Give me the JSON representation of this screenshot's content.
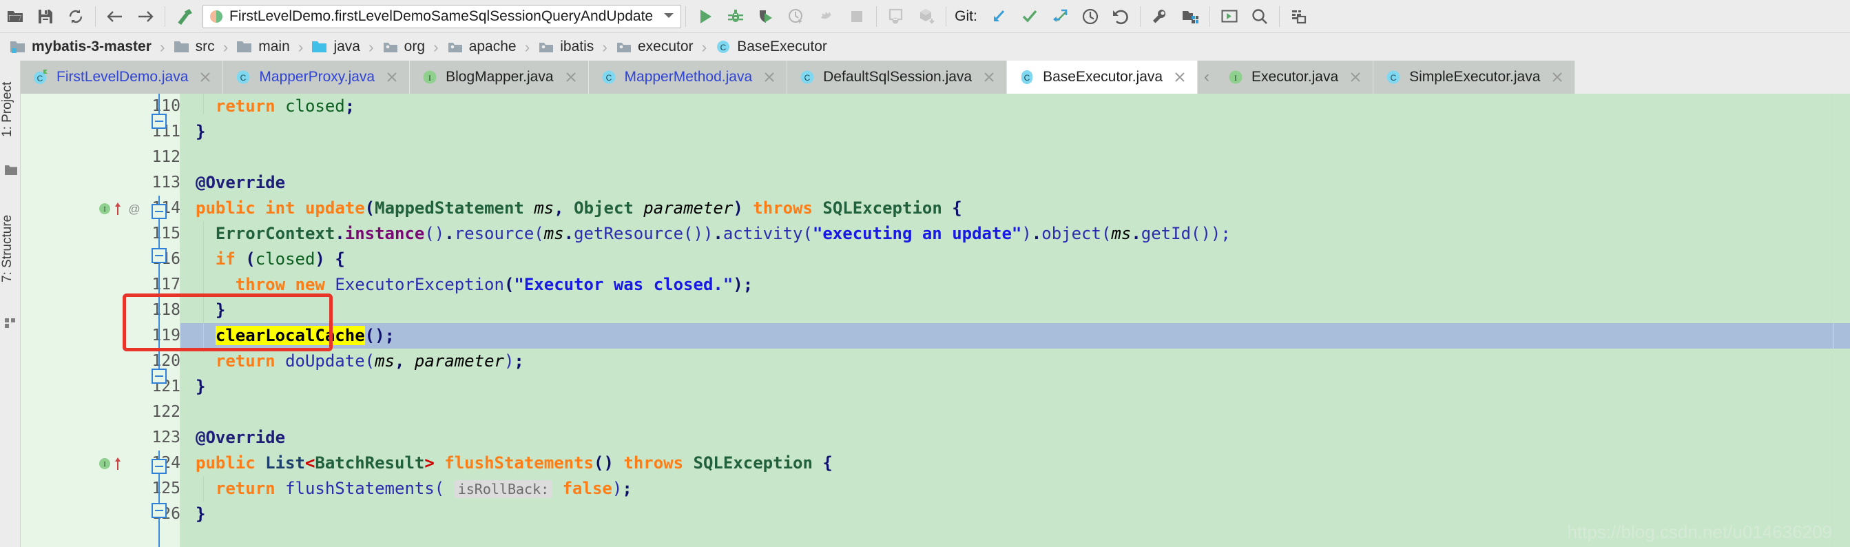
{
  "toolbar": {
    "icons_left": [
      {
        "name": "open-folder-icon",
        "label": "Open"
      },
      {
        "name": "save-all-icon",
        "label": "Save All"
      },
      {
        "name": "sync-icon",
        "label": "Synchronize"
      }
    ],
    "nav_icons": [
      {
        "name": "back-arrow-icon",
        "label": "Back"
      },
      {
        "name": "forward-arrow-icon",
        "label": "Forward"
      }
    ],
    "build_icon": {
      "name": "build-hammer-icon",
      "label": "Build Project"
    },
    "run_config": {
      "value": "FirstLevelDemo.firstLevelDemoSameSqlSessionQueryAndUpdate",
      "icon": "junit-config-icon",
      "dropdown_icon": "chevron-down-icon"
    },
    "run_icons": [
      {
        "name": "run-icon",
        "label": "Run"
      },
      {
        "name": "debug-icon",
        "label": "Debug"
      },
      {
        "name": "run-with-coverage-icon",
        "label": "Run with Coverage"
      },
      {
        "name": "profile-icon",
        "label": "Profile"
      },
      {
        "name": "attach-profiler-icon",
        "label": "Attach Profiler"
      },
      {
        "name": "stop-icon",
        "label": "Stop"
      }
    ],
    "android_icons": [
      {
        "name": "sync-gradle-icon",
        "label": "Sync Project"
      },
      {
        "name": "avd-manager-icon",
        "label": "AVD Manager"
      }
    ],
    "git_label": "Git:",
    "git_icons": [
      {
        "name": "update-project-icon",
        "label": "Update Project"
      },
      {
        "name": "commit-checkmark-icon",
        "label": "Commit"
      },
      {
        "name": "push-icon",
        "label": "Push"
      },
      {
        "name": "history-clock-icon",
        "label": "Show History"
      },
      {
        "name": "rollback-icon",
        "label": "Rollback"
      }
    ],
    "right_icons": [
      {
        "name": "settings-wrench-icon",
        "label": "Settings"
      },
      {
        "name": "project-structure-icon",
        "label": "Project Structure"
      },
      {
        "name": "run-anything-icon",
        "label": "Run Anything"
      },
      {
        "name": "search-everywhere-icon",
        "label": "Search Everywhere"
      },
      {
        "name": "select-in-icon",
        "label": "Select In"
      }
    ]
  },
  "breadcrumb": {
    "items": [
      {
        "label": "mybatis-3-master",
        "icon": "module-icon",
        "bold": true
      },
      {
        "label": "src",
        "icon": "folder-icon",
        "bold": false
      },
      {
        "label": "main",
        "icon": "folder-icon",
        "bold": false
      },
      {
        "label": "java",
        "icon": "source-root-icon",
        "bold": false
      },
      {
        "label": "org",
        "icon": "package-icon",
        "bold": false
      },
      {
        "label": "apache",
        "icon": "package-icon",
        "bold": false
      },
      {
        "label": "ibatis",
        "icon": "package-icon",
        "bold": false
      },
      {
        "label": "executor",
        "icon": "package-icon",
        "bold": false
      },
      {
        "label": "BaseExecutor",
        "icon": "class-icon",
        "bold": false
      }
    ],
    "separator": "›"
  },
  "left_tool_window": {
    "items": [
      {
        "label": "1: Project",
        "number": "1",
        "icon": "project-folder-icon"
      },
      {
        "label": "7: Structure",
        "number": "7",
        "icon": "structure-icon"
      }
    ]
  },
  "tabs": {
    "close_glyph": "✕",
    "overflow_glyph": "‹",
    "items": [
      {
        "label": "FirstLevelDemo.java",
        "icon": "java-class-test-icon",
        "kind": "C",
        "modified": true,
        "active": false
      },
      {
        "label": "MapperProxy.java",
        "icon": "java-class-icon",
        "kind": "C",
        "modified": true,
        "active": false
      },
      {
        "label": "BlogMapper.java",
        "icon": "java-interface-icon",
        "kind": "I",
        "modified": false,
        "active": false
      },
      {
        "label": "MapperMethod.java",
        "icon": "java-class-icon",
        "kind": "C",
        "modified": true,
        "active": false
      },
      {
        "label": "DefaultSqlSession.java",
        "icon": "java-class-icon",
        "kind": "C",
        "modified": false,
        "active": false
      },
      {
        "label": "BaseExecutor.java",
        "icon": "java-class-icon",
        "kind": "C",
        "modified": false,
        "active": true
      },
      {
        "label": "Executor.java",
        "icon": "java-interface-icon",
        "kind": "I",
        "modified": false,
        "active": false
      },
      {
        "label": "SimpleExecutor.java",
        "icon": "java-class-icon",
        "kind": "C",
        "modified": false,
        "active": false
      }
    ]
  },
  "editor": {
    "selected_line": 119,
    "highlight_token": "clearLocalCache",
    "colors": {
      "background": "#c8e6c9",
      "gutter": "#e7f6e7",
      "selection": "#a8bedb",
      "search_highlight": "#ffff00",
      "annotation_box": "#e8352a",
      "keyword": "#ff7d16",
      "string": "#1919e6",
      "class_name": "#20603c",
      "method_call": "#7a0874",
      "generic": "#cc0000"
    },
    "lines": [
      {
        "number": "110",
        "text": "    return closed;"
      },
      {
        "number": "111",
        "text": "  }"
      },
      {
        "number": "112",
        "text": ""
      },
      {
        "number": "113",
        "text": "  @Override"
      },
      {
        "number": "114",
        "text": "  public int update(MappedStatement ms, Object parameter) throws SQLException {"
      },
      {
        "number": "115",
        "text": "    ErrorContext.instance().resource(ms.getResource()).activity(\"executing an update\").object(ms.getId());"
      },
      {
        "number": "116",
        "text": "    if (closed) {"
      },
      {
        "number": "117",
        "text": "      throw new ExecutorException(\"Executor was closed.\");"
      },
      {
        "number": "118",
        "text": "    }"
      },
      {
        "number": "119",
        "text": "    clearLocalCache();"
      },
      {
        "number": "120",
        "text": "    return doUpdate(ms, parameter);"
      },
      {
        "number": "121",
        "text": "  }"
      },
      {
        "number": "122",
        "text": ""
      },
      {
        "number": "123",
        "text": "  @Override"
      },
      {
        "number": "124",
        "text": "  public List<BatchResult> flushStatements() throws SQLException {"
      },
      {
        "number": "125",
        "text": "    return flushStatements( isRollBack: false);"
      },
      {
        "number": "126",
        "text": "  }"
      }
    ],
    "inlay_hints": [
      {
        "line": "125",
        "text": "isRollBack:"
      }
    ],
    "gutter_markers": [
      {
        "line": "114",
        "icons": [
          "implementing-method-icon",
          "overriding-method-arrow-icon",
          "annotation-at-icon"
        ]
      },
      {
        "line": "124",
        "icons": [
          "implementing-method-icon",
          "overriding-method-arrow-icon"
        ]
      }
    ]
  },
  "watermark": "https://blog.csdn.net/u014636209"
}
